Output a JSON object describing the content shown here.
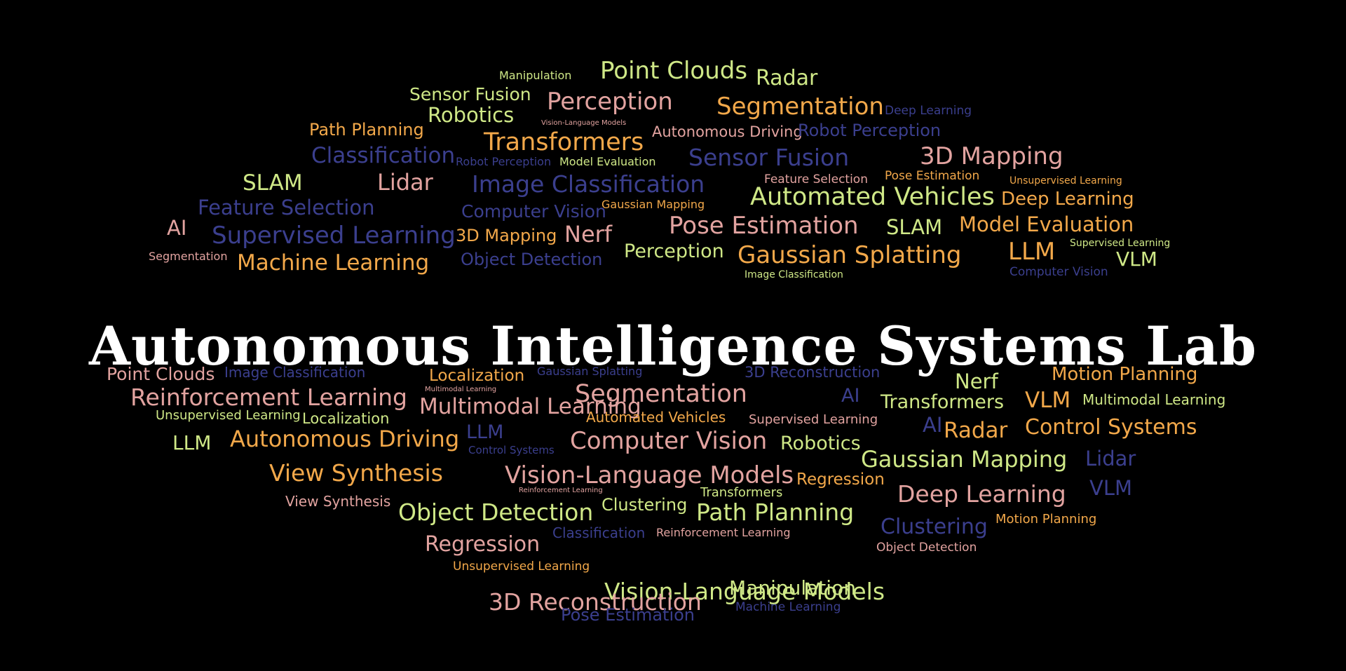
{
  "banner": {
    "title": "Autonomous Intelligence Systems Lab",
    "colors": {
      "background": "#000000",
      "title": "#ffffff",
      "palette": {
        "lime": "#cfe887",
        "green": "#a9d86a",
        "yellow": "#e8e07a",
        "orange": "#f2a84a",
        "pink": "#e2a3a0",
        "blue": "#3b3f8e"
      }
    }
  },
  "words": [
    {
      "text": "Manipulation",
      "color": "lime"
    },
    {
      "text": "Point Clouds",
      "color": "lime"
    },
    {
      "text": "Radar",
      "color": "lime"
    },
    {
      "text": "Sensor Fusion",
      "color": "lime"
    },
    {
      "text": "Perception",
      "color": "pink"
    },
    {
      "text": "Robotics",
      "color": "lime"
    },
    {
      "text": "Segmentation",
      "color": "orange"
    },
    {
      "text": "Deep Learning",
      "color": "blue"
    },
    {
      "text": "Path Planning",
      "color": "orange"
    },
    {
      "text": "Vision-Language Models",
      "color": "pink"
    },
    {
      "text": "Transformers",
      "color": "orange"
    },
    {
      "text": "Autonomous Driving",
      "color": "pink"
    },
    {
      "text": "Robot Perception",
      "color": "blue"
    },
    {
      "text": "Classification",
      "color": "blue"
    },
    {
      "text": "Robot Perception",
      "color": "blue"
    },
    {
      "text": "Model Evaluation",
      "color": "lime"
    },
    {
      "text": "Sensor Fusion",
      "color": "blue"
    },
    {
      "text": "3D Mapping",
      "color": "pink"
    },
    {
      "text": "SLAM",
      "color": "lime"
    },
    {
      "text": "Lidar",
      "color": "pink"
    },
    {
      "text": "Image Classification",
      "color": "blue"
    },
    {
      "text": "Feature Selection",
      "color": "pink"
    },
    {
      "text": "Pose Estimation",
      "color": "orange"
    },
    {
      "text": "Unsupervised Learning",
      "color": "orange"
    },
    {
      "text": "Feature Selection",
      "color": "blue"
    },
    {
      "text": "Computer Vision",
      "color": "blue"
    },
    {
      "text": "Gaussian Mapping",
      "color": "orange"
    },
    {
      "text": "Automated Vehicles",
      "color": "lime"
    },
    {
      "text": "Deep Learning",
      "color": "orange"
    },
    {
      "text": "AI",
      "color": "pink"
    },
    {
      "text": "Supervised Learning",
      "color": "blue"
    },
    {
      "text": "3D Mapping",
      "color": "orange"
    },
    {
      "text": "Nerf",
      "color": "pink"
    },
    {
      "text": "Pose Estimation",
      "color": "pink"
    },
    {
      "text": "SLAM",
      "color": "lime"
    },
    {
      "text": "Model Evaluation",
      "color": "orange"
    },
    {
      "text": "Segmentation",
      "color": "pink"
    },
    {
      "text": "Machine Learning",
      "color": "orange"
    },
    {
      "text": "Object Detection",
      "color": "blue"
    },
    {
      "text": "Perception",
      "color": "lime"
    },
    {
      "text": "Gaussian Splatting",
      "color": "orange"
    },
    {
      "text": "LLM",
      "color": "orange"
    },
    {
      "text": "Supervised Learning",
      "color": "lime"
    },
    {
      "text": "VLM",
      "color": "lime"
    },
    {
      "text": "Image Classification",
      "color": "lime"
    },
    {
      "text": "Computer Vision",
      "color": "blue"
    },
    {
      "text": "Point Clouds",
      "color": "pink"
    },
    {
      "text": "Image Classification",
      "color": "blue"
    },
    {
      "text": "Localization",
      "color": "orange"
    },
    {
      "text": "Gaussian Splatting",
      "color": "blue"
    },
    {
      "text": "3D Reconstruction",
      "color": "blue"
    },
    {
      "text": "Nerf",
      "color": "lime"
    },
    {
      "text": "Motion Planning",
      "color": "orange"
    },
    {
      "text": "Reinforcement Learning",
      "color": "pink"
    },
    {
      "text": "Multimodal Learning",
      "color": "pink"
    },
    {
      "text": "Segmentation",
      "color": "pink"
    },
    {
      "text": "Multimodal Learning",
      "color": "pink"
    },
    {
      "text": "AI",
      "color": "blue"
    },
    {
      "text": "Transformers",
      "color": "lime"
    },
    {
      "text": "VLM",
      "color": "orange"
    },
    {
      "text": "Multimodal Learning",
      "color": "lime"
    },
    {
      "text": "Unsupervised Learning",
      "color": "lime"
    },
    {
      "text": "Localization",
      "color": "lime"
    },
    {
      "text": "Automated Vehicles",
      "color": "orange"
    },
    {
      "text": "Supervised Learning",
      "color": "pink"
    },
    {
      "text": "AI",
      "color": "blue"
    },
    {
      "text": "Radar",
      "color": "orange"
    },
    {
      "text": "Control Systems",
      "color": "orange"
    },
    {
      "text": "LLM",
      "color": "lime"
    },
    {
      "text": "Autonomous Driving",
      "color": "orange"
    },
    {
      "text": "LLM",
      "color": "blue"
    },
    {
      "text": "Computer Vision",
      "color": "pink"
    },
    {
      "text": "Robotics",
      "color": "lime"
    },
    {
      "text": "Control Systems",
      "color": "blue"
    },
    {
      "text": "Gaussian Mapping",
      "color": "lime"
    },
    {
      "text": "Lidar",
      "color": "blue"
    },
    {
      "text": "View Synthesis",
      "color": "orange"
    },
    {
      "text": "Vision-Language Models",
      "color": "pink"
    },
    {
      "text": "Regression",
      "color": "orange"
    },
    {
      "text": "Reinforcement Learning",
      "color": "pink"
    },
    {
      "text": "Transformers",
      "color": "lime"
    },
    {
      "text": "Deep Learning",
      "color": "pink"
    },
    {
      "text": "VLM",
      "color": "blue"
    },
    {
      "text": "View Synthesis",
      "color": "pink"
    },
    {
      "text": "Object Detection",
      "color": "lime"
    },
    {
      "text": "Clustering",
      "color": "lime"
    },
    {
      "text": "Path Planning",
      "color": "lime"
    },
    {
      "text": "Clustering",
      "color": "blue"
    },
    {
      "text": "Motion Planning",
      "color": "orange"
    },
    {
      "text": "Classification",
      "color": "blue"
    },
    {
      "text": "Reinforcement Learning",
      "color": "pink"
    },
    {
      "text": "Regression",
      "color": "pink"
    },
    {
      "text": "Object Detection",
      "color": "pink"
    },
    {
      "text": "Unsupervised Learning",
      "color": "orange"
    },
    {
      "text": "Vision-Language Models",
      "color": "lime"
    },
    {
      "text": "3D Reconstruction",
      "color": "pink"
    },
    {
      "text": "Manipulation",
      "color": "lime"
    },
    {
      "text": "Pose Estimation",
      "color": "blue"
    },
    {
      "text": "Machine Learning",
      "color": "blue"
    }
  ]
}
